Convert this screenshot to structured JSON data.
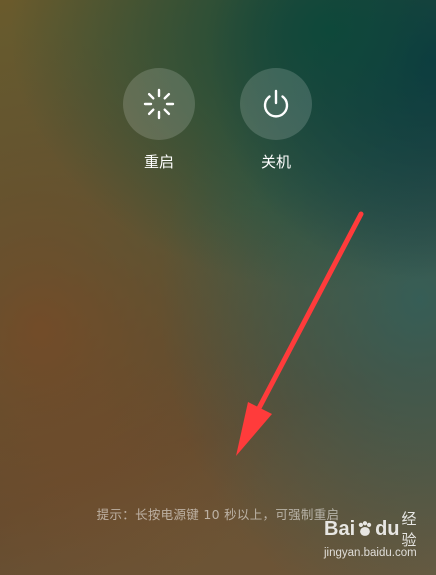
{
  "power_menu": {
    "reboot_label": "重启",
    "shutdown_label": "关机",
    "reboot_icon": "loading-spinner-icon",
    "shutdown_icon": "power-icon"
  },
  "hint_text": "提示：长按电源键 10 秒以上，可强制重启",
  "annotation": {
    "arrow_color": "#ff3b3b"
  },
  "watermark": {
    "brand_left": "Bai",
    "brand_right": "du",
    "brand_cn": "经验",
    "url": "jingyan.baidu.com"
  },
  "colors": {
    "button_fill": "rgba(255,255,255,0.16)",
    "label_text": "#ffffff",
    "hint_text": "rgba(255,255,255,0.55)"
  }
}
